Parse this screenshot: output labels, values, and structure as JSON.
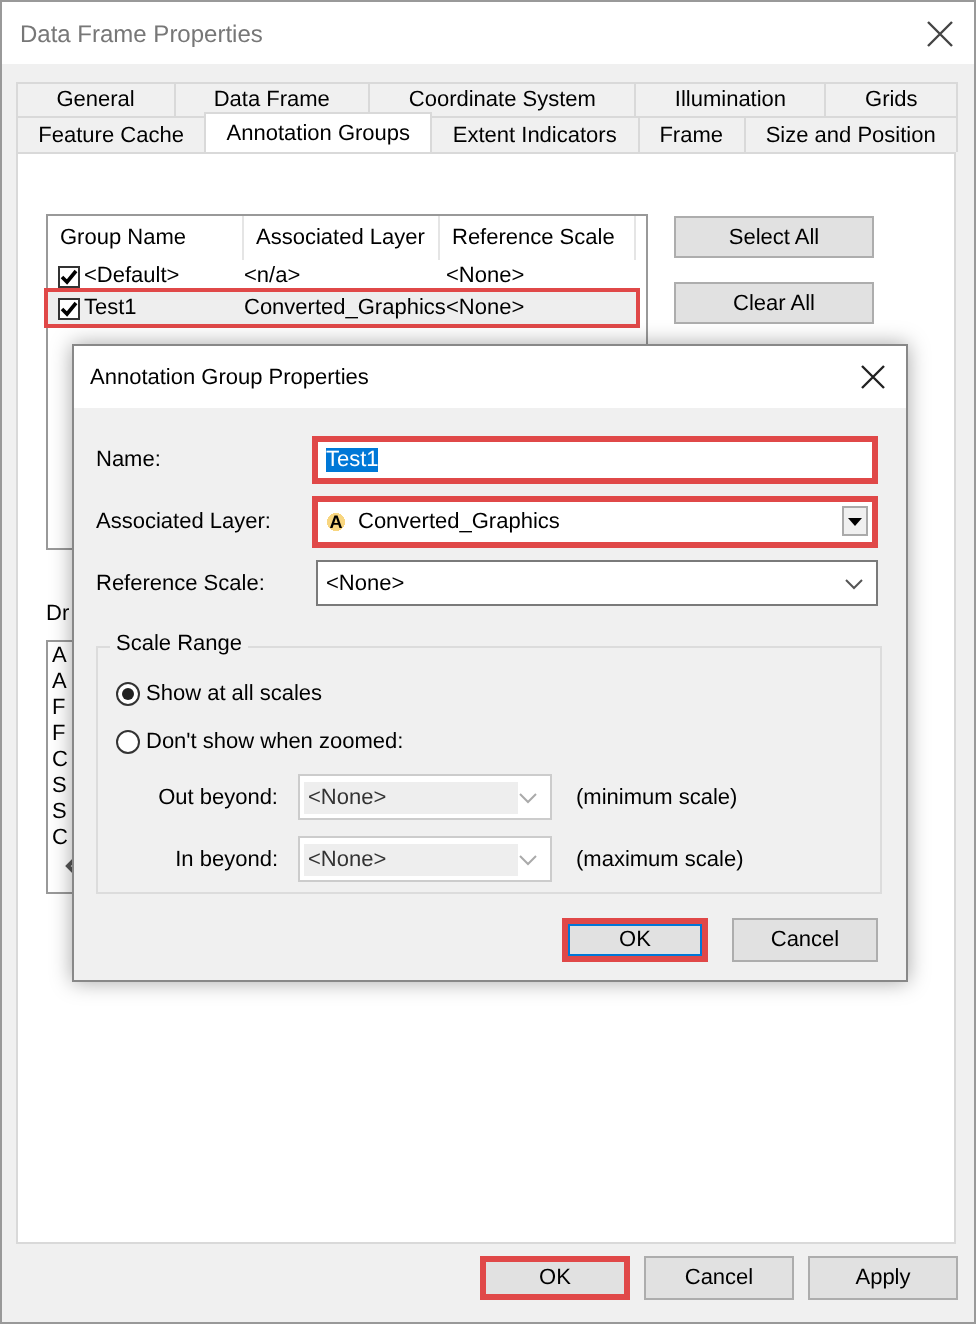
{
  "window": {
    "title": "Data Frame Properties"
  },
  "tabs": [
    [
      {
        "label": "General",
        "selected": false
      },
      {
        "label": "Data Frame",
        "selected": false
      },
      {
        "label": "Coordinate System",
        "selected": false
      },
      {
        "label": "Illumination",
        "selected": false
      },
      {
        "label": "Grids",
        "selected": false
      }
    ],
    [
      {
        "label": "Feature Cache",
        "selected": false
      },
      {
        "label": "Annotation Groups",
        "selected": true
      },
      {
        "label": "Extent Indicators",
        "selected": false
      },
      {
        "label": "Frame",
        "selected": false
      },
      {
        "label": "Size and Position",
        "selected": false
      }
    ]
  ],
  "group_table": {
    "columns": [
      "Group Name",
      "Associated Layer",
      "Reference Scale"
    ],
    "rows": [
      {
        "checked": true,
        "highlighted": false,
        "cells": [
          "<Default>",
          "<n/a>",
          "<None>"
        ]
      },
      {
        "checked": true,
        "highlighted": true,
        "cells": [
          "Test1",
          "Converted_Graphics",
          "<None>"
        ]
      }
    ]
  },
  "side_buttons": [
    "Select All",
    "Clear All"
  ],
  "draw_label": "Dr",
  "draw_list": [
    "A",
    "A",
    "F",
    "F",
    "C",
    "S",
    "S",
    "C"
  ],
  "dialog": {
    "title": "Annotation Group Properties",
    "name": {
      "label": "Name:",
      "value": "Test1",
      "text_selected": true,
      "highlighted": true
    },
    "layer": {
      "label": "Associated Layer:",
      "icon_letter": "A",
      "value": "Converted_Graphics",
      "highlighted": true
    },
    "reference_scale": {
      "label": "Reference Scale:",
      "value": "<None>"
    },
    "scale_range": {
      "title": "Scale Range",
      "options": [
        {
          "label": "Show at all scales",
          "selected": true
        },
        {
          "label": "Don't show when zoomed:",
          "selected": false
        }
      ],
      "limits": [
        {
          "label": "Out beyond:",
          "value": "<None>",
          "note": "(minimum scale)",
          "disabled": true
        },
        {
          "label": "In beyond:",
          "value": "<None>",
          "note": "(maximum scale)",
          "disabled": true
        }
      ]
    },
    "buttons": [
      {
        "label": "OK",
        "highlighted": true,
        "default": true
      },
      {
        "label": "Cancel",
        "highlighted": false,
        "default": false
      }
    ]
  },
  "buttons": [
    {
      "label": "OK",
      "highlighted": true
    },
    {
      "label": "Cancel",
      "highlighted": false
    },
    {
      "label": "Apply",
      "highlighted": false
    }
  ]
}
